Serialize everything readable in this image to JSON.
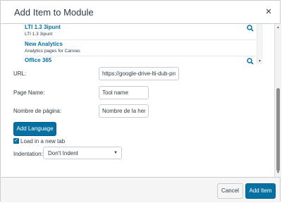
{
  "dialog": {
    "title": "Add Item to Module",
    "close_glyph": "×"
  },
  "tools": [
    {
      "name": "LTI 1.3 3ipunt",
      "description": "LTI 1.3 3ipunt",
      "has_search": true
    },
    {
      "name": "New Analytics",
      "description": "Analytics pages for Canvas",
      "has_search": false
    },
    {
      "name": "Office 365",
      "description": "",
      "has_search": true
    }
  ],
  "form": {
    "url_label": "URL:",
    "url_value": "https://google-drive-lti-dub-prod",
    "page_name_label": "Page Name:",
    "page_name_value": "Tool name",
    "nombre_label": "Nombre de página:",
    "nombre_value": "Nombre de la herramienta",
    "add_language_label": "Add Language",
    "load_new_tab_label": "Load in a new tab",
    "load_new_tab_checked": true,
    "indentation_label": "Indentation:",
    "indentation_value": "Don't Indent"
  },
  "footer": {
    "cancel_label": "Cancel",
    "add_item_label": "Add Item"
  },
  "colors": {
    "accent": "#0770a3",
    "border": "#c7cdd1",
    "text": "#2d3b45",
    "footer_bg": "#f5f5f5"
  }
}
